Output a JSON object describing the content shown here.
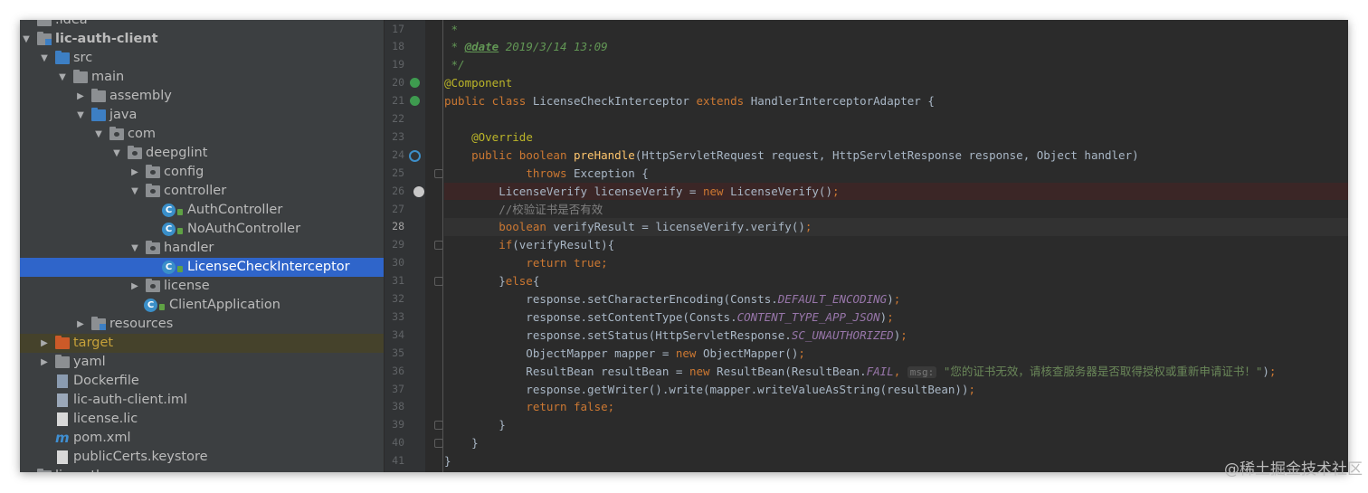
{
  "project_tree": {
    "items": [
      {
        "label": ".idea",
        "depth": 0
      },
      {
        "label": "lic-auth-client",
        "depth": 0,
        "expanded": true
      },
      {
        "label": "src",
        "depth": 1,
        "expanded": true
      },
      {
        "label": "main",
        "depth": 2,
        "expanded": true
      },
      {
        "label": "assembly",
        "depth": 3,
        "expanded": false
      },
      {
        "label": "java",
        "depth": 3,
        "expanded": true
      },
      {
        "label": "com",
        "depth": 4,
        "expanded": true
      },
      {
        "label": "deepglint",
        "depth": 5,
        "expanded": true
      },
      {
        "label": "config",
        "depth": 6,
        "expanded": false
      },
      {
        "label": "controller",
        "depth": 6,
        "expanded": true
      },
      {
        "label": "AuthController",
        "depth": 7
      },
      {
        "label": "NoAuthController",
        "depth": 7
      },
      {
        "label": "handler",
        "depth": 6,
        "expanded": true
      },
      {
        "label": "LicenseCheckInterceptor",
        "depth": 7,
        "selected": true
      },
      {
        "label": "license",
        "depth": 6,
        "expanded": false
      },
      {
        "label": "ClientApplication",
        "depth": 6
      },
      {
        "label": "resources",
        "depth": 3,
        "expanded": false
      },
      {
        "label": "target",
        "depth": 1,
        "expanded": false
      },
      {
        "label": "yaml",
        "depth": 1,
        "expanded": false
      },
      {
        "label": "Dockerfile",
        "depth": 1
      },
      {
        "label": "lic-auth-client.iml",
        "depth": 1
      },
      {
        "label": "license.lic",
        "depth": 1
      },
      {
        "label": "pom.xml",
        "depth": 1
      },
      {
        "label": "publicCerts.keystore",
        "depth": 1
      },
      {
        "label": "lic-auth-common",
        "depth": 0
      }
    ]
  },
  "editor": {
    "current_line": 28,
    "error_line": 26,
    "lines": [
      {
        "n": 17,
        "tokens": [
          [
            "dc",
            " *"
          ]
        ]
      },
      {
        "n": 18,
        "tokens": [
          [
            "dc",
            " * "
          ],
          [
            "dt",
            "@date"
          ],
          [
            "dc",
            " 2019/3/14 13:09"
          ]
        ]
      },
      {
        "n": 19,
        "tokens": [
          [
            "dc",
            " */"
          ]
        ]
      },
      {
        "n": 20,
        "tokens": [
          [
            "an",
            "@Component"
          ]
        ]
      },
      {
        "n": 21,
        "tokens": [
          [
            "kw",
            "public class "
          ],
          [
            "tx",
            "LicenseCheckInterceptor "
          ],
          [
            "kw",
            "extends "
          ],
          [
            "tx",
            "HandlerInterceptorAdapter {"
          ]
        ]
      },
      {
        "n": 22,
        "tokens": []
      },
      {
        "n": 23,
        "tokens": [
          [
            "tx",
            "    "
          ],
          [
            "an",
            "@Override"
          ]
        ]
      },
      {
        "n": 24,
        "tokens": [
          [
            "tx",
            "    "
          ],
          [
            "kw",
            "public boolean "
          ],
          [
            "mt",
            "preHandle"
          ],
          [
            "tx",
            "(HttpServletRequest request, HttpServletResponse response, Object handler)"
          ]
        ]
      },
      {
        "n": 25,
        "tokens": [
          [
            "tx",
            "            "
          ],
          [
            "kw",
            "throws "
          ],
          [
            "tx",
            "Exception {"
          ]
        ]
      },
      {
        "n": 26,
        "tokens": [
          [
            "tx",
            "        LicenseVerify licenseVerify = "
          ],
          [
            "kw",
            "new "
          ],
          [
            "tx",
            "LicenseVerify()"
          ],
          [
            "kw",
            ";"
          ]
        ]
      },
      {
        "n": 27,
        "tokens": [
          [
            "cm",
            "        //校验证书是否有效"
          ]
        ]
      },
      {
        "n": 28,
        "tokens": [
          [
            "tx",
            "        "
          ],
          [
            "kw",
            "boolean "
          ],
          [
            "tx",
            "verifyResult = licenseVerify.verify()"
          ],
          [
            "kw",
            ";"
          ]
        ]
      },
      {
        "n": 29,
        "tokens": [
          [
            "tx",
            "        "
          ],
          [
            "kw",
            "if"
          ],
          [
            "tx",
            "(verifyResult){"
          ]
        ]
      },
      {
        "n": 30,
        "tokens": [
          [
            "tx",
            "            "
          ],
          [
            "kw",
            "return true;"
          ]
        ]
      },
      {
        "n": 31,
        "tokens": [
          [
            "tx",
            "        }"
          ],
          [
            "kw",
            "else"
          ],
          [
            "tx",
            "{"
          ]
        ]
      },
      {
        "n": 32,
        "tokens": [
          [
            "tx",
            "            response.setCharacterEncoding(Consts."
          ],
          [
            "fl",
            "DEFAULT_ENCODING"
          ],
          [
            "tx",
            ")"
          ],
          [
            "kw",
            ";"
          ]
        ]
      },
      {
        "n": 33,
        "tokens": [
          [
            "tx",
            "            response.setContentType(Consts."
          ],
          [
            "fl",
            "CONTENT_TYPE_APP_JSON"
          ],
          [
            "tx",
            ")"
          ],
          [
            "kw",
            ";"
          ]
        ]
      },
      {
        "n": 34,
        "tokens": [
          [
            "tx",
            "            response.setStatus(HttpServletResponse."
          ],
          [
            "fl",
            "SC_UNAUTHORIZED"
          ],
          [
            "tx",
            ")"
          ],
          [
            "kw",
            ";"
          ]
        ]
      },
      {
        "n": 35,
        "tokens": [
          [
            "tx",
            "            ObjectMapper mapper = "
          ],
          [
            "kw",
            "new "
          ],
          [
            "tx",
            "ObjectMapper()"
          ],
          [
            "kw",
            ";"
          ]
        ]
      },
      {
        "n": 36,
        "tokens": [
          [
            "tx",
            "            ResultBean resultBean = "
          ],
          [
            "kw",
            "new "
          ],
          [
            "tx",
            "ResultBean(ResultBean."
          ],
          [
            "fl",
            "FAIL"
          ],
          [
            "kw",
            ", "
          ],
          [
            "hint",
            "msg:"
          ],
          [
            "st",
            " \"您的证书无效，请核查服务器是否取得授权或重新申请证书！\""
          ],
          [
            "tx",
            ")"
          ],
          [
            "kw",
            ";"
          ]
        ]
      },
      {
        "n": 37,
        "tokens": [
          [
            "tx",
            "            response.getWriter().write(mapper.writeValueAsString(resultBean))"
          ],
          [
            "kw",
            ";"
          ]
        ]
      },
      {
        "n": 38,
        "tokens": [
          [
            "tx",
            "            "
          ],
          [
            "kw",
            "return false;"
          ]
        ]
      },
      {
        "n": 39,
        "tokens": [
          [
            "tx",
            "        }"
          ]
        ]
      },
      {
        "n": 40,
        "tokens": [
          [
            "tx",
            "    }"
          ]
        ]
      },
      {
        "n": 41,
        "tokens": [
          [
            "tx",
            "}"
          ]
        ]
      }
    ]
  },
  "watermark": "@稀土掘金技术社区",
  "colors": {
    "editor_bg": "#2b2b2b",
    "tree_bg": "#3c3f41",
    "selection": "#2f65ca",
    "keyword": "#cc7832",
    "annotation": "#bbb529",
    "method": "#ffc66d",
    "field": "#9876aa",
    "string": "#6a8759",
    "comment": "#808080",
    "doc": "#629755"
  }
}
